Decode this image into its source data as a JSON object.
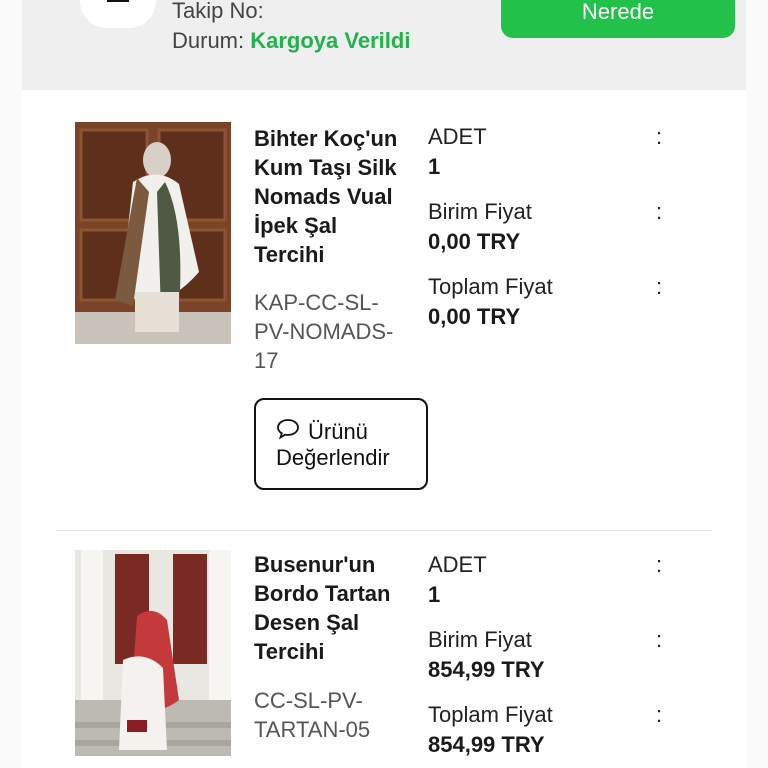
{
  "shipment": {
    "tracking_label": "Takip No:",
    "status_label": "Durum:",
    "status_value": "Kargoya Verildi",
    "where_button": "Nerede"
  },
  "items": [
    {
      "name_lines": [
        "Bihter Koç'un",
        "Kum Taşı Silk",
        "Nomads Vual",
        "İpek Şal",
        "Tercihi"
      ],
      "sku_lines": [
        "KAP-CC-SL-",
        "PV-NOMADS-",
        "17"
      ],
      "qty_label": "ADET",
      "qty_value": "1",
      "unit_price_label": "Birim Fiyat",
      "unit_price_value": "0,00 TRY",
      "total_price_label": "Toplam Fiyat",
      "total_price_value": "0,00 TRY",
      "rate_button_line1": "Ürünü",
      "rate_button_line2": "Değerlendir",
      "rate_icon": "chat-bubble-icon"
    },
    {
      "name_lines": [
        "Busenur'un",
        "Bordo Tartan",
        "Desen Şal",
        "Tercihi"
      ],
      "sku_lines": [
        "CC-SL-PV-",
        "TARTAN-05"
      ],
      "qty_label": "ADET",
      "qty_value": "1",
      "unit_price_label": "Birim Fiyat",
      "unit_price_value": "854,99 TRY",
      "total_price_label": "Toplam Fiyat",
      "total_price_value": "854,99 TRY"
    }
  ],
  "colon": ":",
  "colors": {
    "accent_green": "#22c24a",
    "status_green": "#22b24c"
  }
}
